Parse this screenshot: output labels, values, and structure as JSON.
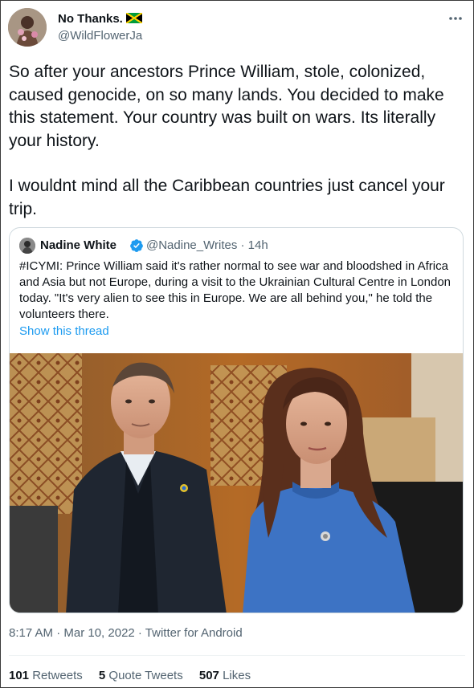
{
  "tweet": {
    "display_name": "No Thanks.",
    "flag_icon": "jamaica-flag-icon",
    "handle": "@WildFlowerJa",
    "text_paragraph_1": "So after your ancestors Prince William, stole, colonized, caused genocide, on so many lands. You decided to make this statement. Your country was built on wars. Its literally your history.",
    "text_paragraph_2": "I wouldnt mind all the Caribbean countries just cancel your trip.",
    "timestamp": "8:17 AM · Mar 10, 2022 · Twitter for Android"
  },
  "quoted_tweet": {
    "display_name": "Nadine White",
    "verified_icon": "verified-badge-icon",
    "handle_time": "@Nadine_Writes · 14h",
    "text": "#ICYMI: Prince William said it's rather normal to see war and bloodshed in Africa and Asia but not Europe, during a visit to the Ukrainian Cultural Centre in London today. \"It's very alien to see this in Europe. We are all behind you,\" he told the volunteers there.",
    "show_thread": "Show this thread"
  },
  "stats": {
    "retweets_count": "101",
    "retweets_label": "Retweets",
    "quote_tweets_count": "5",
    "quote_tweets_label": "Quote Tweets",
    "likes_count": "507",
    "likes_label": "Likes"
  },
  "colors": {
    "link_blue": "#1d9bf0",
    "secondary_text": "#536471",
    "primary_text": "#0f1419",
    "border": "#cfd9de"
  }
}
